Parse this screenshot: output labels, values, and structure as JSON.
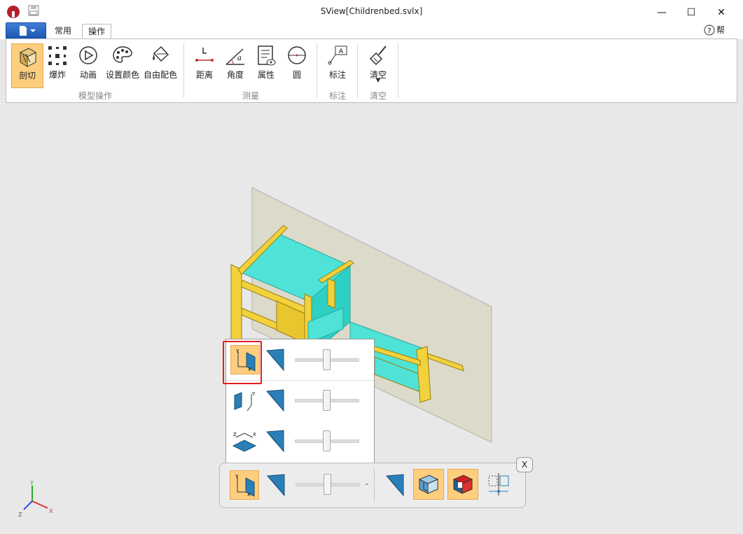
{
  "window": {
    "title": "SView[Childrenbed.svlx]",
    "minimize": "—",
    "maximize": "☐",
    "close": "✕"
  },
  "tabs": {
    "common": "常用",
    "operate": "操作"
  },
  "help": {
    "label": "帮助"
  },
  "ribbon": {
    "section": "剖切",
    "explode": "爆炸",
    "animate": "动画",
    "set_color": "设置颜色",
    "free_color": "自由配色",
    "distance": "距离",
    "angle": "角度",
    "property": "属性",
    "circle": "圆",
    "annotate": "标注",
    "clear": "清空",
    "groups": {
      "model_ops": "模型操作",
      "measure": "测量",
      "annotate": "标注",
      "clear": "清空"
    }
  },
  "axes": {
    "x": "X",
    "y": "Y",
    "z": "Z"
  },
  "popup": {
    "rows": [
      {
        "plane": "YX",
        "slider": 0.5
      },
      {
        "plane": "YZ",
        "slider": 0.5
      },
      {
        "plane": "ZX",
        "slider": 0.5
      }
    ]
  },
  "toolbar": {
    "close_label": "X",
    "slider": 0.5
  },
  "colors": {
    "accent": "#fdce7e",
    "highlight": "#e02020",
    "part_wood": "#f2d23c",
    "part_mattress": "#4ee3d6",
    "plane": "#dcdacb"
  },
  "icons": [
    "app-logo-icon",
    "save-icon",
    "file-menu-icon",
    "help-icon",
    "section-icon",
    "explode-icon",
    "animate-icon",
    "palette-icon",
    "paint-bucket-icon",
    "distance-icon",
    "angle-icon",
    "property-icon",
    "circle-icon",
    "annotation-icon",
    "broom-icon"
  ]
}
